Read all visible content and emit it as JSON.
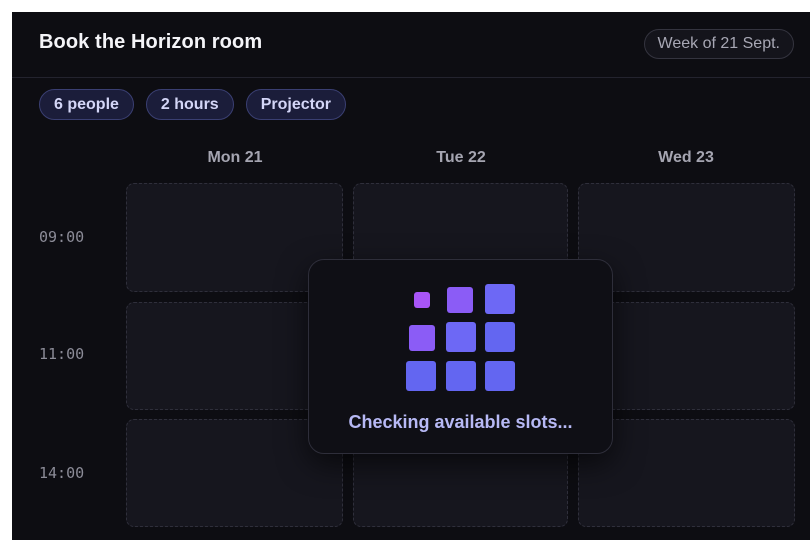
{
  "header": {
    "title": "Book the Horizon room",
    "week_label": "Week of 21 Sept."
  },
  "filters": [
    {
      "label": "6 people"
    },
    {
      "label": "2 hours"
    },
    {
      "label": "Projector"
    }
  ],
  "days": [
    {
      "label": "Mon 21"
    },
    {
      "label": "Tue 22"
    },
    {
      "label": "Wed 23"
    }
  ],
  "times": [
    {
      "label": "09:00"
    },
    {
      "label": "11:00"
    },
    {
      "label": "14:00"
    }
  ],
  "loading": {
    "message": "Checking available slots..."
  },
  "colors": {
    "background": "#0d0d12",
    "accent_indigo": "#6366f1",
    "accent_violet": "#a855f7"
  }
}
